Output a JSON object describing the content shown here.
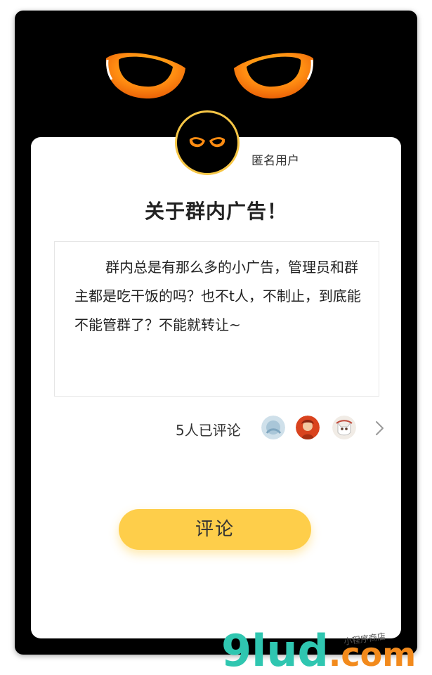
{
  "post": {
    "author": "匿名用户",
    "title": "关于群内广告！",
    "body": "群内总是有那么多的小广告，管理员和群主都是吃干饭的吗？也不t人，不制止，到底能不能管群了？不能就转让~"
  },
  "comments": {
    "count_text": "5人已评论",
    "avatars": [
      "commenter-avatar-1",
      "commenter-avatar-2",
      "commenter-avatar-3"
    ]
  },
  "actions": {
    "comment_label": "评论"
  },
  "watermark": {
    "text": "9lud.com",
    "handwriting": "小程序商店"
  },
  "colors": {
    "accent_yellow": "#fece4a",
    "eye_orange": "#f47a12",
    "background": "#000000"
  }
}
